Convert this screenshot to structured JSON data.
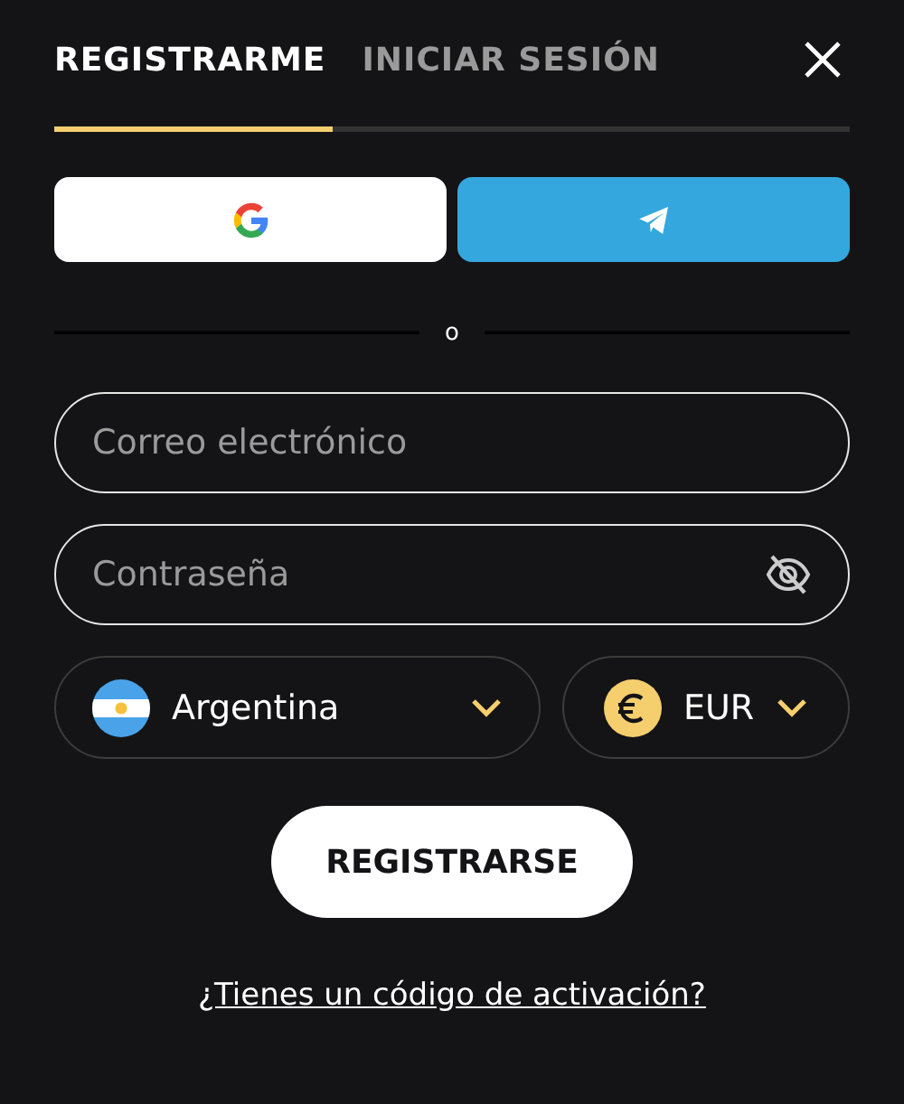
{
  "tabs": [
    {
      "label": "REGISTRARME",
      "selected": true
    },
    {
      "label": "INICIAR SESIÓN",
      "selected": false
    }
  ],
  "divider_text": "o",
  "email": {
    "placeholder": "Correo electrónico"
  },
  "password": {
    "placeholder": "Contraseña",
    "visible": false
  },
  "country": {
    "value": "Argentina"
  },
  "currency": {
    "value": "EUR"
  },
  "submit": "REGISTRARSE",
  "activation_link": "¿Tienes un código de activación?"
}
